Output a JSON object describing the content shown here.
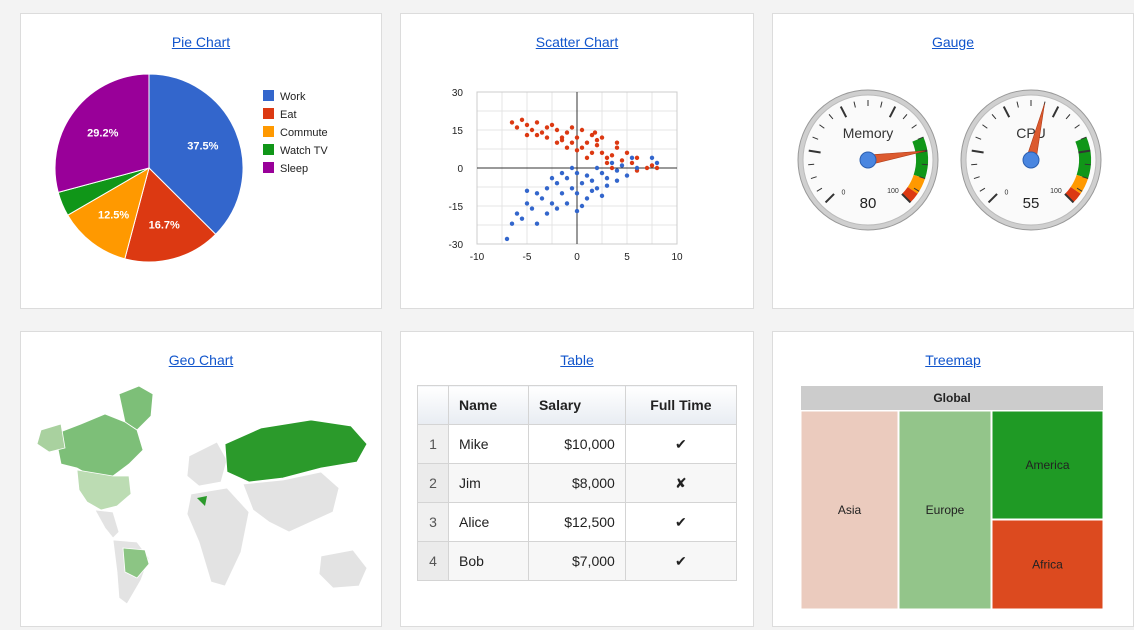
{
  "cards": {
    "pie": "Pie Chart",
    "scatter": "Scatter Chart",
    "gauge": "Gauge",
    "geo": "Geo Chart",
    "table": "Table",
    "treemap": "Treemap"
  },
  "colors": {
    "link": "#1155cc",
    "blue": "#3366cc",
    "red": "#dc3912",
    "orange": "#ff9900",
    "green": "#109618",
    "purple": "#990099"
  },
  "chart_data": [
    {
      "type": "pie",
      "categories": [
        "Work",
        "Eat",
        "Commute",
        "Watch TV",
        "Sleep"
      ],
      "values": [
        37.5,
        16.7,
        12.5,
        4.2,
        29.2
      ],
      "labels": [
        "37.5%",
        "16.7%",
        "12.5%",
        "",
        "29.2%"
      ],
      "colors": [
        "#3366cc",
        "#dc3912",
        "#ff9900",
        "#109618",
        "#990099"
      ],
      "legend": "right"
    },
    {
      "type": "scatter",
      "xlim": [
        -10,
        10
      ],
      "ylim": [
        -30,
        30
      ],
      "xticks": [
        "-10",
        "-5",
        "0",
        "5",
        "10"
      ],
      "yticks": [
        "30",
        "15",
        "0",
        "-15",
        "-30"
      ],
      "grid": true,
      "series": [
        {
          "color": "#dc3912",
          "points": [
            [
              -6.5,
              18
            ],
            [
              -6,
              16
            ],
            [
              -5.5,
              19
            ],
            [
              -5,
              17
            ],
            [
              -4.5,
              15
            ],
            [
              -4,
              18
            ],
            [
              -3.5,
              14
            ],
            [
              -3,
              16
            ],
            [
              -2.5,
              17
            ],
            [
              -2,
              15
            ],
            [
              -1.5,
              12
            ],
            [
              -1,
              14
            ],
            [
              -0.5,
              10
            ],
            [
              0,
              12
            ],
            [
              0.5,
              8
            ],
            [
              1,
              10
            ],
            [
              1.5,
              13
            ],
            [
              2,
              11
            ],
            [
              2.5,
              6
            ],
            [
              3,
              4
            ],
            [
              3.5,
              5
            ],
            [
              4,
              8
            ],
            [
              4.5,
              3
            ],
            [
              5,
              6
            ],
            [
              5.5,
              2
            ],
            [
              6,
              4
            ],
            [
              7,
              0
            ],
            [
              7.5,
              1
            ],
            [
              -3,
              12
            ],
            [
              -1,
              8
            ],
            [
              0.5,
              15
            ],
            [
              1.5,
              6
            ],
            [
              2,
              9
            ],
            [
              -2,
              10
            ],
            [
              3,
              2
            ],
            [
              -4,
              13
            ],
            [
              1,
              4
            ],
            [
              2.5,
              12
            ],
            [
              -0.5,
              16
            ],
            [
              4,
              10
            ],
            [
              0,
              7
            ],
            [
              1.8,
              14
            ],
            [
              -1.5,
              11
            ],
            [
              3.5,
              0
            ],
            [
              6,
              -1
            ],
            [
              8,
              0
            ],
            [
              -5,
              13
            ]
          ]
        },
        {
          "color": "#3366cc",
          "points": [
            [
              -7,
              -28
            ],
            [
              -6.5,
              -22
            ],
            [
              -6,
              -18
            ],
            [
              -5.5,
              -20
            ],
            [
              -5,
              -14
            ],
            [
              -4.5,
              -16
            ],
            [
              -4,
              -10
            ],
            [
              -3.5,
              -12
            ],
            [
              -3,
              -8
            ],
            [
              -2.5,
              -14
            ],
            [
              -2,
              -6
            ],
            [
              -1.5,
              -10
            ],
            [
              -1,
              -4
            ],
            [
              -0.5,
              -8
            ],
            [
              0,
              -2
            ],
            [
              0.5,
              -6
            ],
            [
              1,
              -3
            ],
            [
              1.5,
              -5
            ],
            [
              2,
              0
            ],
            [
              2.5,
              -2
            ],
            [
              3,
              -4
            ],
            [
              3.5,
              2
            ],
            [
              4,
              -1
            ],
            [
              4.5,
              1
            ],
            [
              5,
              -3
            ],
            [
              5.5,
              4
            ],
            [
              6,
              0
            ],
            [
              7.5,
              4
            ],
            [
              8,
              2
            ],
            [
              -1,
              -14
            ],
            [
              0,
              -10
            ],
            [
              1,
              -12
            ],
            [
              -2,
              -16
            ],
            [
              -3,
              -18
            ],
            [
              2,
              -8
            ],
            [
              0.5,
              -15
            ],
            [
              -4,
              -22
            ],
            [
              -1.5,
              -2
            ],
            [
              3,
              -7
            ],
            [
              4,
              -5
            ],
            [
              -0.5,
              0
            ],
            [
              1.5,
              -9
            ],
            [
              2.5,
              -11
            ],
            [
              -2.5,
              -4
            ],
            [
              0,
              -17
            ],
            [
              -5,
              -9
            ]
          ]
        }
      ]
    },
    {
      "type": "gauge",
      "series": [
        {
          "name": "Memory",
          "value": 80
        },
        {
          "name": "CPU",
          "value": 55
        }
      ],
      "range": [
        0,
        100
      ],
      "min_label": "0",
      "max_label": "100"
    },
    {
      "type": "geo",
      "regions": [
        "Canada",
        "Greenland",
        "USA",
        "Brazil",
        "Russia",
        "Central America"
      ]
    },
    {
      "type": "table",
      "columns": [
        "",
        "Name",
        "Salary",
        "Full Time"
      ],
      "rows": [
        [
          "1",
          "Mike",
          "$10,000",
          "✔"
        ],
        [
          "2",
          "Jim",
          "$8,000",
          "✘"
        ],
        [
          "3",
          "Alice",
          "$12,500",
          "✔"
        ],
        [
          "4",
          "Bob",
          "$7,000",
          "✔"
        ]
      ]
    },
    {
      "type": "treemap",
      "root": "Global",
      "nodes": [
        {
          "label": "Asia",
          "color": "#ebcbbe"
        },
        {
          "label": "Europe",
          "color": "#93c58a"
        },
        {
          "label": "America",
          "color": "#1f9a25"
        },
        {
          "label": "Africa",
          "color": "#dc4a1f"
        }
      ]
    }
  ]
}
